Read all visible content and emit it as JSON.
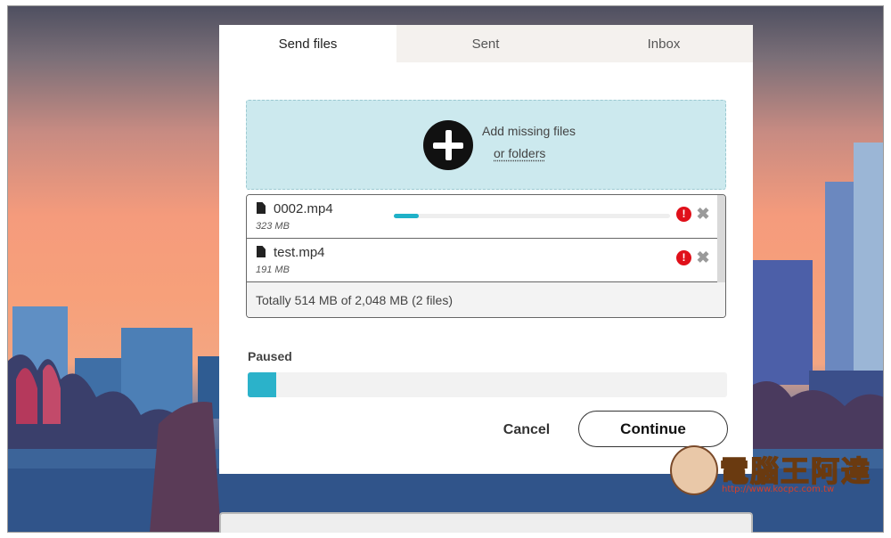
{
  "tabs": [
    {
      "label": "Send files",
      "active": true
    },
    {
      "label": "Sent",
      "active": false
    },
    {
      "label": "Inbox",
      "active": false
    }
  ],
  "dropzone": {
    "icon": "plus-circle-icon",
    "line1": "Add missing files",
    "line2": "or folders"
  },
  "files": [
    {
      "name": "0002.mp4",
      "size": "323 MB",
      "progress": 0.09,
      "status": "error"
    },
    {
      "name": "test.mp4",
      "size": "191 MB",
      "progress": null,
      "status": "error"
    }
  ],
  "total": "Totally 514 MB of 2,048 MB (2 files)",
  "status_label": "Paused",
  "overall_progress": 0.06,
  "actions": {
    "cancel": "Cancel",
    "continue": "Continue"
  },
  "watermark": {
    "text": "電腦王阿達",
    "url": "http://www.kocpc.com.tw"
  },
  "colors": {
    "accent": "#2bb2ca",
    "dropzone_bg": "#cce9ee",
    "error": "#e0101a"
  }
}
